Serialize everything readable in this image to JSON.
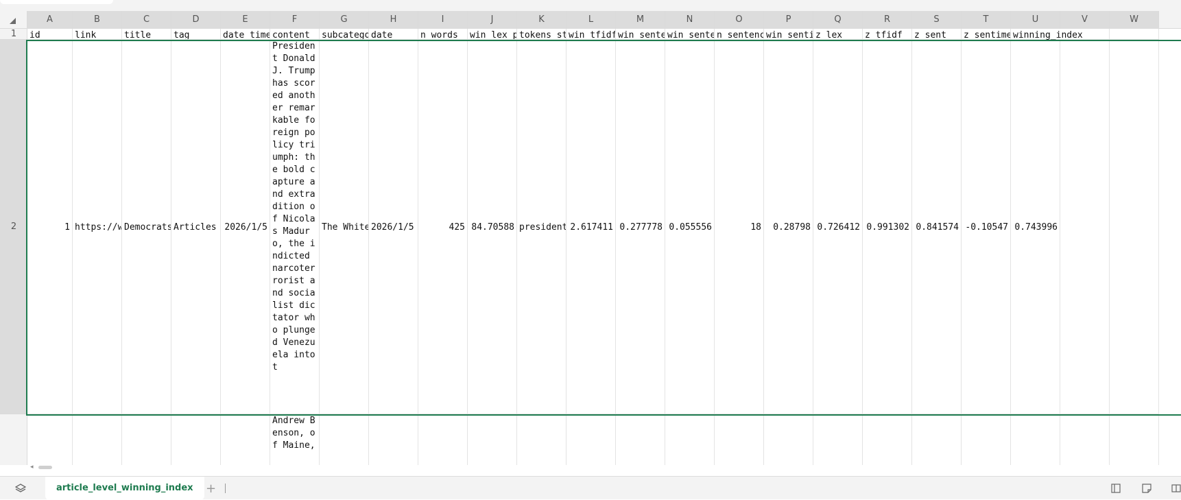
{
  "columns": [
    "A",
    "B",
    "C",
    "D",
    "E",
    "F",
    "G",
    "H",
    "I",
    "J",
    "K",
    "L",
    "M",
    "N",
    "O",
    "P",
    "Q",
    "R",
    "S",
    "T",
    "U",
    "V",
    "W"
  ],
  "rows": [
    "1",
    "2"
  ],
  "header_row": [
    "id",
    "link",
    "title",
    "tag",
    "date_time",
    "content",
    "subcategory",
    "date",
    "n_words",
    "win_lex_p",
    "tokens_st",
    "win_tfidf",
    "win_sente",
    "win_sente",
    "n_sentenc",
    "win_senti",
    "z_lex",
    "z_tfidf",
    "z_sent",
    "z_sentime",
    "winning_index"
  ],
  "row2": {
    "id": "1",
    "link": "https://w",
    "title": "Democrats",
    "tag": "Articles",
    "date_time": "2026/1/5",
    "content": "President Donald J. Trump has scored another remarkable foreign policy triumph: the bold capture and extradition of Nicolas Maduro, the indicted narcoterrorist and socialist dictator who plunged Venezuela into t",
    "subcategory": "The White",
    "date": "2026/1/5",
    "n_words": "425",
    "win_lex_p": "84.70588",
    "tokens_st": "president",
    "win_tfidf": "2.617411",
    "win_sente": "0.277778",
    "win_sente2": "0.055556",
    "n_sentenc": "18",
    "win_senti": "0.28798",
    "z_lex": "0.726412",
    "z_tfidf": "0.991302",
    "z_sent": "0.841574",
    "z_sentime": "-0.10547",
    "winning_index": "0.743996"
  },
  "row3": {
    "content": "Andrew Benson, of Maine,"
  },
  "sheet_tab": "article_level_winning_index",
  "add_sheet_symbol": "+",
  "icons": {
    "sheets": "layers-icon",
    "corner": "select-all-triangle-icon",
    "bottom_right": [
      "page-layout-icon",
      "note-icon",
      "view-icon"
    ]
  },
  "accent_color": "#1e7b4f"
}
